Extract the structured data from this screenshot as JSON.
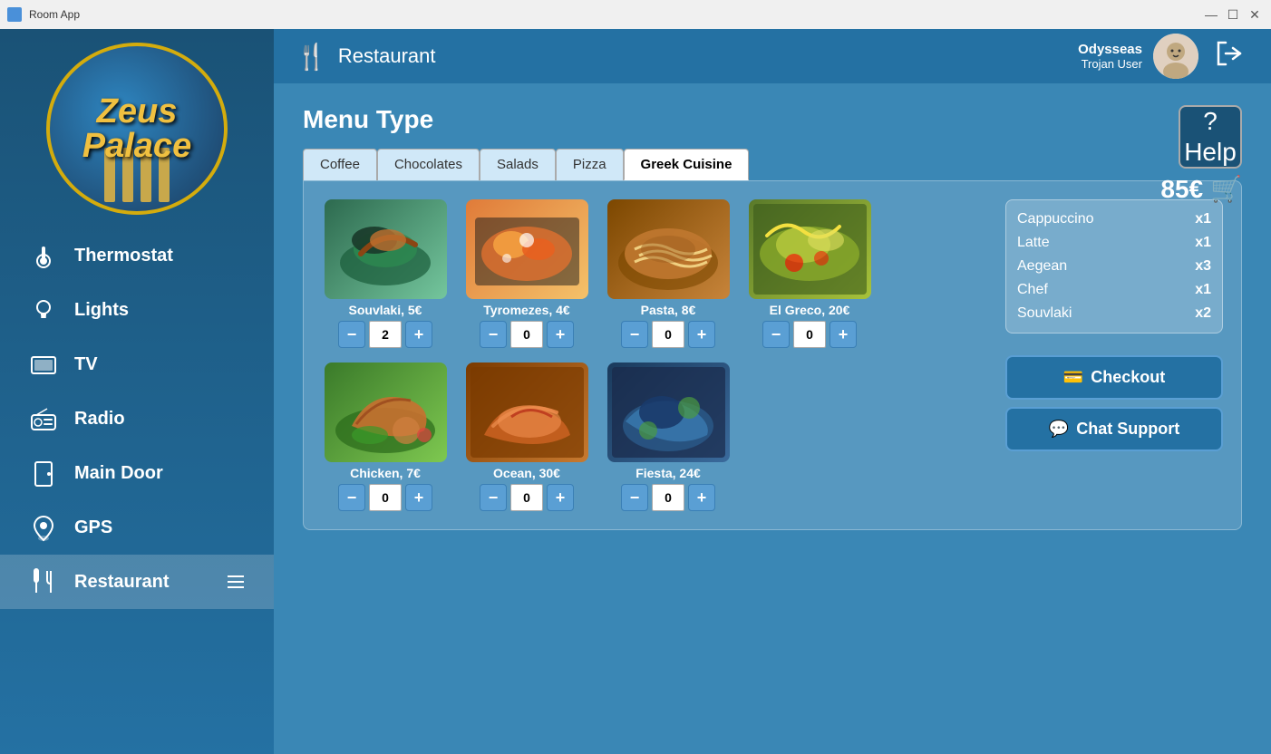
{
  "titlebar": {
    "title": "Room App",
    "minimize": "—",
    "maximize": "☐",
    "close": "✕"
  },
  "sidebar": {
    "logo_text": "Zeus\nPalace",
    "nav_items": [
      {
        "id": "thermostat",
        "label": "Thermostat",
        "icon": "🌡"
      },
      {
        "id": "lights",
        "label": "Lights",
        "icon": "💡"
      },
      {
        "id": "tv",
        "label": "TV",
        "icon": "📺"
      },
      {
        "id": "radio",
        "label": "Radio",
        "icon": "📻"
      },
      {
        "id": "maindoor",
        "label": "Main Door",
        "icon": "🚪"
      },
      {
        "id": "gps",
        "label": "GPS",
        "icon": "📍"
      },
      {
        "id": "restaurant",
        "label": "Restaurant",
        "icon": "🍽",
        "active": true
      }
    ]
  },
  "header": {
    "icon": "🍴",
    "title": "Restaurant",
    "user_name": "Odysseas",
    "user_role": "Trojan User",
    "logout_icon": "→"
  },
  "content": {
    "menu_type_label": "Menu Type",
    "help_label": "Help",
    "cart_total": "85€",
    "tabs": [
      {
        "id": "coffee",
        "label": "Coffee",
        "active": false
      },
      {
        "id": "chocolates",
        "label": "Chocolates",
        "active": false
      },
      {
        "id": "salads",
        "label": "Salads",
        "active": false
      },
      {
        "id": "pizza",
        "label": "Pizza",
        "active": false
      },
      {
        "id": "greek",
        "label": "Greek Cuisine",
        "active": true
      }
    ],
    "food_items": [
      {
        "id": "souvlaki",
        "label": "Souvlaki, 5€",
        "qty": 2,
        "css_class": "food-souvlaki"
      },
      {
        "id": "tyromezes",
        "label": "Tyromezes, 4€",
        "qty": 0,
        "css_class": "food-tyromezes"
      },
      {
        "id": "pasta",
        "label": "Pasta, 8€",
        "qty": 0,
        "css_class": "food-pasta"
      },
      {
        "id": "elgreco",
        "label": "El Greco, 20€",
        "qty": 0,
        "css_class": "food-elgreco"
      },
      {
        "id": "chicken",
        "label": "Chicken, 7€",
        "qty": 0,
        "css_class": "food-chicken"
      },
      {
        "id": "ocean",
        "label": "Ocean, 30€",
        "qty": 0,
        "css_class": "food-ocean"
      },
      {
        "id": "fiesta",
        "label": "Fiesta, 24€",
        "qty": 0,
        "css_class": "food-fiesta"
      }
    ],
    "order_items": [
      {
        "name": "Cappuccino",
        "qty": "x1"
      },
      {
        "name": "Latte",
        "qty": "x1"
      },
      {
        "name": "Aegean",
        "qty": "x3"
      },
      {
        "name": "Chef",
        "qty": "x1"
      },
      {
        "name": "Souvlaki",
        "qty": "x2"
      }
    ],
    "checkout_label": "Checkout",
    "chat_label": "Chat Support"
  }
}
